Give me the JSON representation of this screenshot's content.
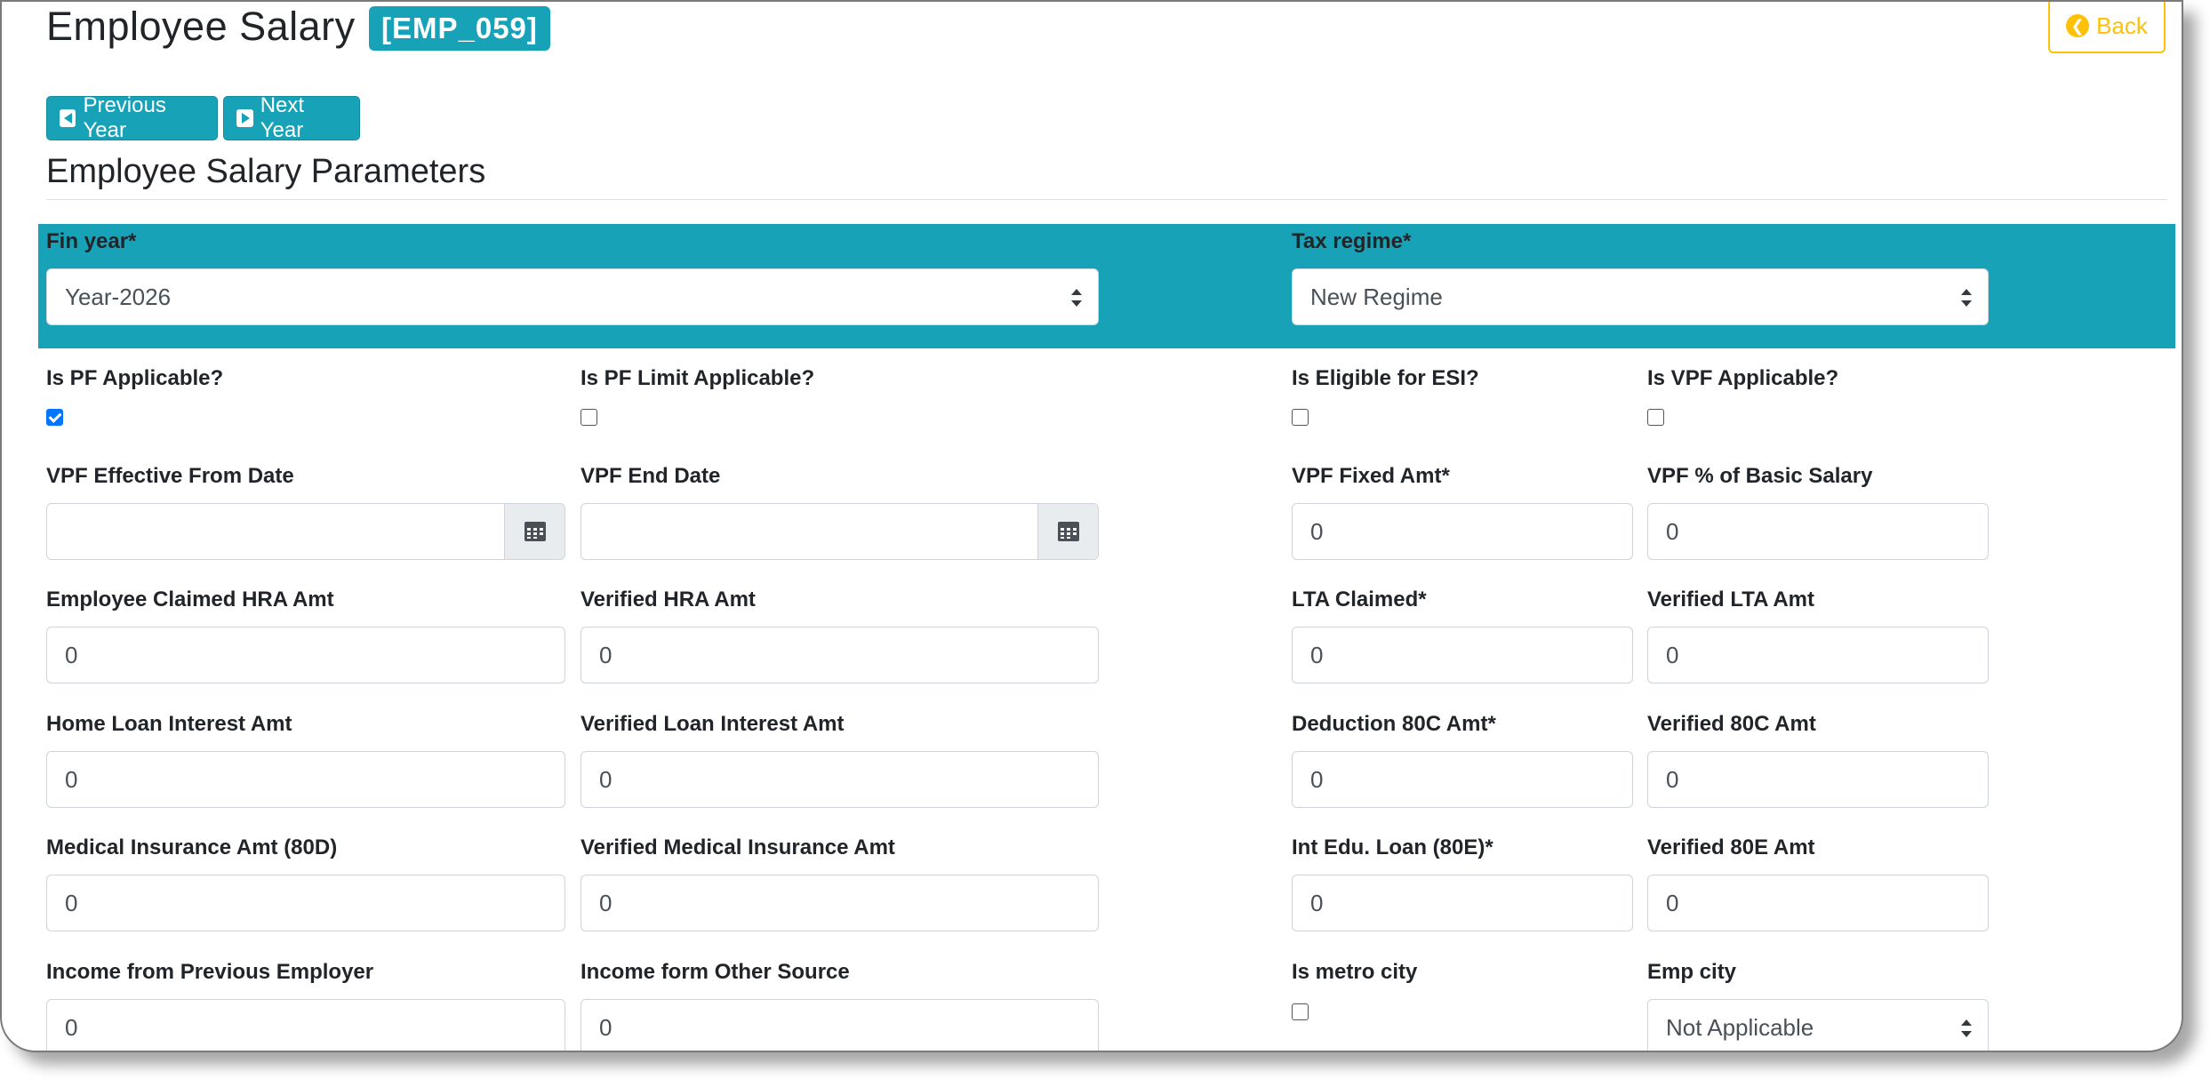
{
  "header": {
    "title": "Employee Salary",
    "emp_code": "[EMP_059]",
    "back_label": "Back",
    "prev_year_label": "Previous Year",
    "next_year_label": "Next Year"
  },
  "section_title": "Employee Salary Parameters",
  "fin_year": {
    "label": "Fin year*",
    "value": "Year-2026"
  },
  "tax_regime": {
    "label": "Tax regime*",
    "value": "New Regime"
  },
  "checks": {
    "pf": {
      "label": "Is PF Applicable?",
      "checked": true
    },
    "pf_limit": {
      "label": "Is PF Limit Applicable?",
      "checked": false
    },
    "esi": {
      "label": "Is Eligible for ESI?",
      "checked": false
    },
    "vpf": {
      "label": "Is VPF Applicable?",
      "checked": false
    },
    "metro": {
      "label": "Is metro city",
      "checked": false
    }
  },
  "fields": {
    "vpf_from": {
      "label": "VPF Effective From Date",
      "value": ""
    },
    "vpf_end": {
      "label": "VPF End Date",
      "value": ""
    },
    "vpf_fixed": {
      "label": "VPF Fixed Amt*",
      "value": "0"
    },
    "vpf_pct": {
      "label": "VPF % of Basic Salary",
      "value": "0"
    },
    "hra_claimed": {
      "label": "Employee Claimed HRA Amt",
      "value": "0"
    },
    "hra_verified": {
      "label": "Verified HRA Amt",
      "value": "0"
    },
    "lta_claimed": {
      "label": "LTA Claimed*",
      "value": "0"
    },
    "lta_verified": {
      "label": "Verified LTA Amt",
      "value": "0"
    },
    "home_loan": {
      "label": "Home Loan Interest Amt",
      "value": "0"
    },
    "loan_verified": {
      "label": "Verified Loan Interest Amt",
      "value": "0"
    },
    "ded_80c": {
      "label": "Deduction 80C Amt*",
      "value": "0"
    },
    "verified_80c": {
      "label": "Verified 80C Amt",
      "value": "0"
    },
    "med_ins": {
      "label": "Medical Insurance Amt (80D)",
      "value": "0"
    },
    "med_verified": {
      "label": "Verified Medical Insurance Amt",
      "value": "0"
    },
    "edu_loan": {
      "label": "Int Edu. Loan (80E)*",
      "value": "0"
    },
    "verified_80e": {
      "label": "Verified 80E Amt",
      "value": "0"
    },
    "prev_employer": {
      "label": "Income from Previous Employer",
      "value": "0"
    },
    "other_source": {
      "label": "Income form Other Source",
      "value": "0"
    }
  },
  "emp_city": {
    "label": "Emp city",
    "value": "Not Applicable"
  },
  "colors": {
    "accent": "#17a2b8",
    "warning": "#ffc107",
    "checkbox": "#0075ff"
  }
}
